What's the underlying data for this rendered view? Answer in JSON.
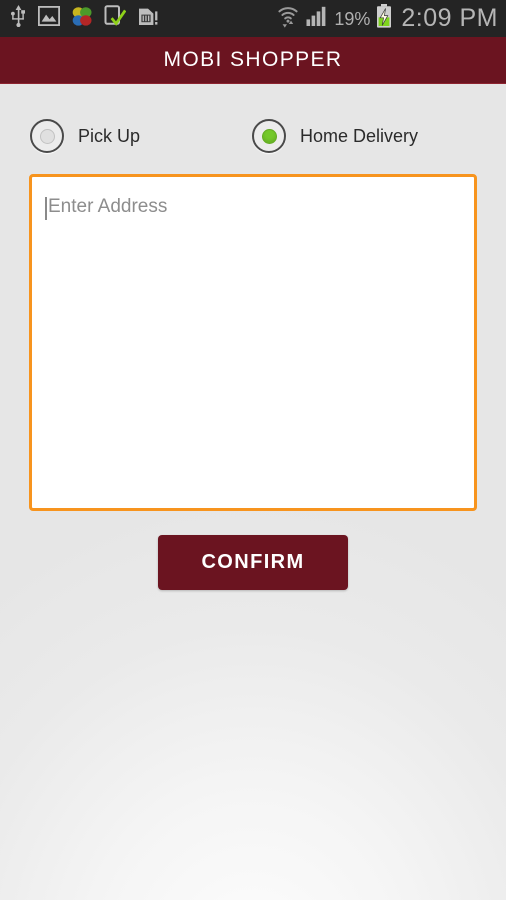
{
  "status_bar": {
    "left_icons": [
      {
        "name": "usb-icon",
        "label": "USB"
      },
      {
        "name": "image-icon",
        "label": "Image"
      },
      {
        "name": "flower-app-icon",
        "label": "Photos"
      },
      {
        "name": "device-check-icon",
        "label": "Device connected"
      },
      {
        "name": "sd-card-warning-icon",
        "label": "SD card"
      }
    ],
    "right_icons": [
      {
        "name": "wifi-icon",
        "label": "Wi-Fi"
      },
      {
        "name": "signal-bars-icon",
        "label": "Signal"
      },
      {
        "name": "battery-charging-icon",
        "label": "Battery charging"
      }
    ],
    "battery_percent": "19%",
    "time": "2:09 PM",
    "background_color": "#242424",
    "text_color": "#b5b5b5"
  },
  "app_bar": {
    "title": "MOBI SHOPPER",
    "background_color": "#6b1420",
    "text_color": "#ffffff"
  },
  "delivery_options": {
    "options": [
      {
        "label": "Pick Up",
        "selected": false
      },
      {
        "label": "Home Delivery",
        "selected": true
      }
    ],
    "selected_color": "#74c82a"
  },
  "address_field": {
    "placeholder": "Enter Address",
    "value": "",
    "border_color": "#f7941e",
    "background_color": "#ffffff",
    "focused": true
  },
  "actions": {
    "confirm_label": "CONFIRM",
    "confirm_background": "#6b1420",
    "confirm_text_color": "#ffffff"
  }
}
